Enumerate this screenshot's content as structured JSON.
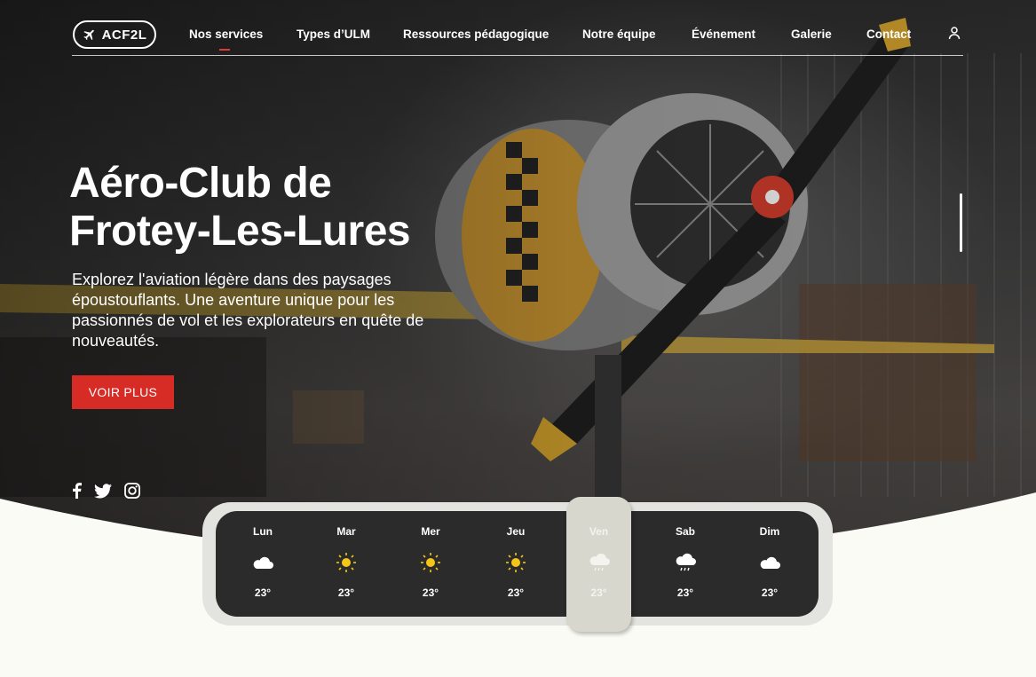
{
  "nav": {
    "logo_text": "ACF2L",
    "menu": [
      {
        "label": "Nos services"
      },
      {
        "label": "Types d’ULM"
      },
      {
        "label": "Ressources pédagogique"
      },
      {
        "label": "Notre équipe"
      },
      {
        "label": "Événement"
      },
      {
        "label": "Galerie"
      },
      {
        "label": "Contact"
      }
    ],
    "active_item": "Nos services",
    "user_icon": "user-icon"
  },
  "hero": {
    "title_line1": "Aéro-Club de",
    "title_line2": "Frotey-Les-Lures",
    "description": "Explorez l'aviation légère dans des paysages époustouflants. Une aventure unique pour les passionnés de vol et les explorateurs en quête de nouveautés.",
    "cta_label": "VOIR PLUS"
  },
  "socials": [
    "facebook-icon",
    "twitter-icon",
    "instagram-icon"
  ],
  "weather": {
    "days": [
      {
        "name": "Lun",
        "icon": "cloud-icon",
        "temp": "23°"
      },
      {
        "name": "Mar",
        "icon": "sun-icon",
        "temp": "23°"
      },
      {
        "name": "Mer",
        "icon": "sun-icon",
        "temp": "23°"
      },
      {
        "name": "Jeu",
        "icon": "sun-icon",
        "temp": "23°"
      },
      {
        "name": "Ven",
        "icon": "rain-cloud-icon",
        "temp": "23°"
      },
      {
        "name": "Sab",
        "icon": "rain-cloud-icon",
        "temp": "23°"
      },
      {
        "name": "Dim",
        "icon": "cloud-icon",
        "temp": "23°"
      }
    ],
    "selected_day": "Ven"
  },
  "colors": {
    "accent": "#d72b26",
    "widget_dark": "#2b2b2b",
    "widget_selected": "#d7d7cd",
    "sun": "#f5c518",
    "page_bg": "#fbfbf6"
  }
}
